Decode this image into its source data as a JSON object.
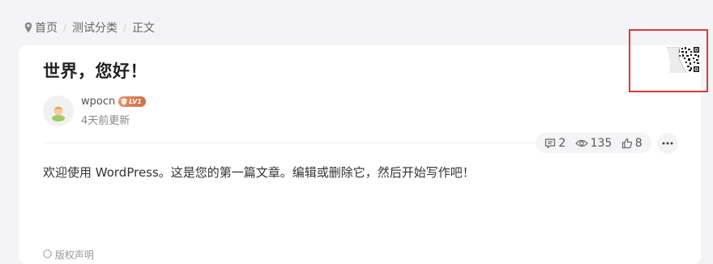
{
  "breadcrumb": {
    "items": [
      "首页",
      "测试分类",
      "正文"
    ],
    "separator": "/"
  },
  "post": {
    "title": "世界，您好！",
    "author": "wpocn",
    "level_badge": "LV1",
    "updated": "4天前更新",
    "content": "欢迎使用 WordPress。这是您的第一篇文章。编辑或删除它，然后开始写作吧！",
    "copyright_label": "版权声明"
  },
  "stats": {
    "comments": "2",
    "views": "135",
    "likes": "8"
  },
  "icons": [
    "location-pin-icon",
    "comment-icon",
    "eye-icon",
    "thumbs-up-icon",
    "more-icon",
    "qr-code-icon",
    "copyright-icon"
  ],
  "colors": {
    "background": "#f4f4f6",
    "card": "#ffffff",
    "level_badge": "#e07f57",
    "highlight_box": "#d93a3a"
  }
}
